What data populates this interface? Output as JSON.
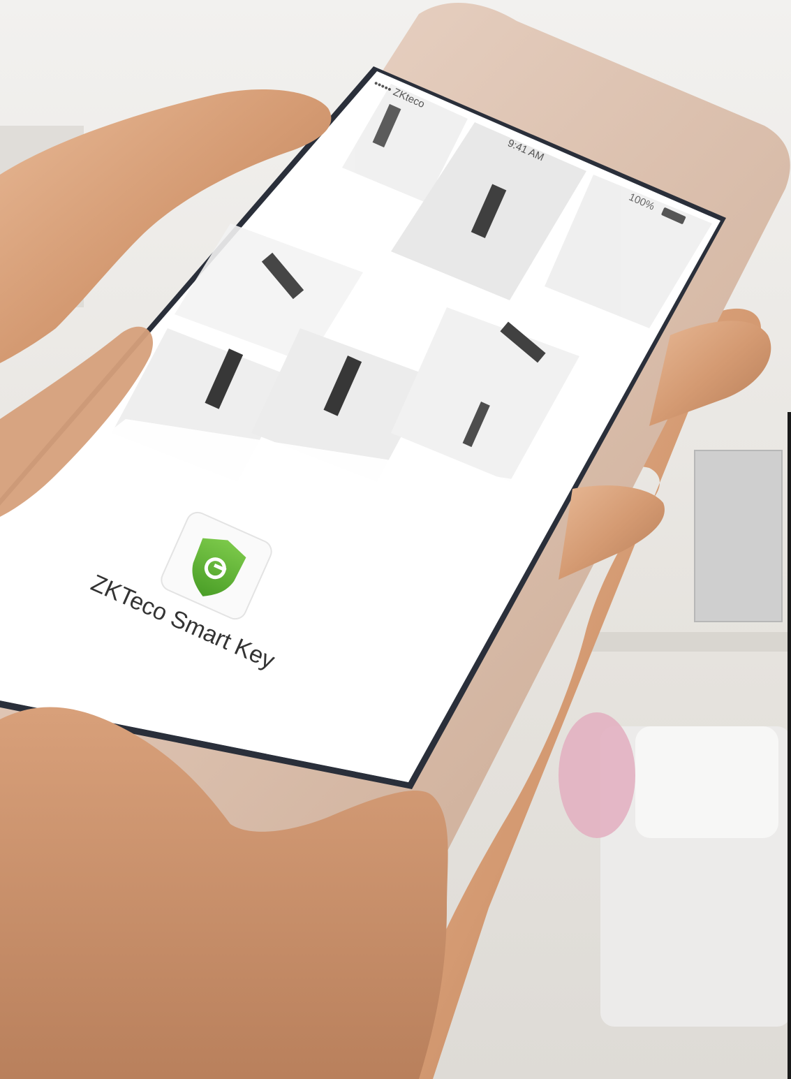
{
  "status_bar": {
    "carrier": "••••• ZKteco",
    "time": "9:41 AM",
    "battery": "100%"
  },
  "app": {
    "name": "ZKTeco Smart Key",
    "icon": "shield-lock-icon",
    "icon_color": "#5cb531",
    "icon_dark": "#3f8f1f"
  },
  "colors": {
    "phone_frame": "#ddc3b2",
    "screen_bezel": "#1e2430",
    "screen": "#ffffff",
    "skin": "#d9a27c",
    "skin_shadow": "#b9805d",
    "room_bg": "#e8e6e2"
  }
}
